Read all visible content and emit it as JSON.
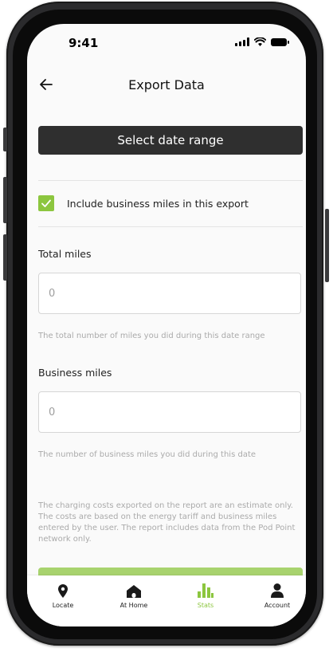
{
  "status_bar": {
    "time": "9:41"
  },
  "header": {
    "title": "Export Data"
  },
  "date_range_button": {
    "label": "Select date range"
  },
  "business_checkbox": {
    "label": "Include business miles in this export",
    "checked": true
  },
  "total_miles": {
    "label": "Total miles",
    "placeholder": "0",
    "helper": "The total number of miles you did during this date range"
  },
  "business_miles": {
    "label": "Business miles",
    "placeholder": "0",
    "helper": "The number of business miles you did during this date"
  },
  "disclaimer": "The charging costs exported on the report are an estimate only. The costs are based on the energy tariff and business miles entered by the user. The report includes data from the Pod Point network only.",
  "tabs": [
    {
      "label": "Locate",
      "icon": "location-pin-icon",
      "active": false
    },
    {
      "label": "At Home",
      "icon": "home-icon",
      "active": false
    },
    {
      "label": "Stats",
      "icon": "bar-chart-icon",
      "active": true
    },
    {
      "label": "Account",
      "icon": "person-icon",
      "active": false
    }
  ],
  "colors": {
    "accent": "#8cc63f",
    "button_dark": "#2f2f2f",
    "export_button": "#a8d36e"
  }
}
